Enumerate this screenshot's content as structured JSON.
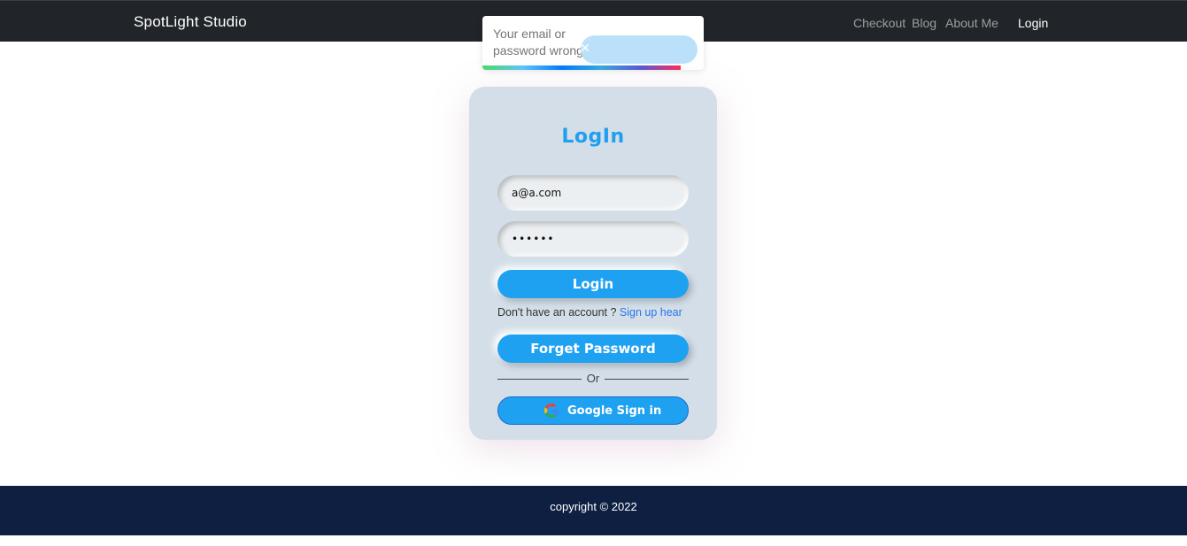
{
  "navbar": {
    "brand": "SpotLight Studio",
    "links": [
      {
        "label": "Checkout"
      },
      {
        "label": "Blog"
      },
      {
        "label": "About Me"
      },
      {
        "label": "Login"
      }
    ]
  },
  "toast": {
    "message": "Your email or password wrong",
    "close_symbol": "✕",
    "close_icon": "close-icon"
  },
  "login_card": {
    "title": "LogIn",
    "email_value": "a@a.com",
    "password_value": "••••••",
    "login_button": "Login",
    "signup_prompt": "Don't have an account ? ",
    "signup_link": "Sign up hear",
    "forget_button": "Forget Password",
    "divider_text": "Or",
    "google_button": "Google Sign in",
    "google_icon": "google-logo-icon"
  },
  "footer": {
    "copyright": "copyright © 2022"
  },
  "colors": {
    "navbar_bg": "#212529",
    "accent_blue": "#1fa1f2",
    "card_bg": "#d3dee8",
    "footer_bg": "#0e1f42",
    "link_blue": "#2a74e8"
  }
}
